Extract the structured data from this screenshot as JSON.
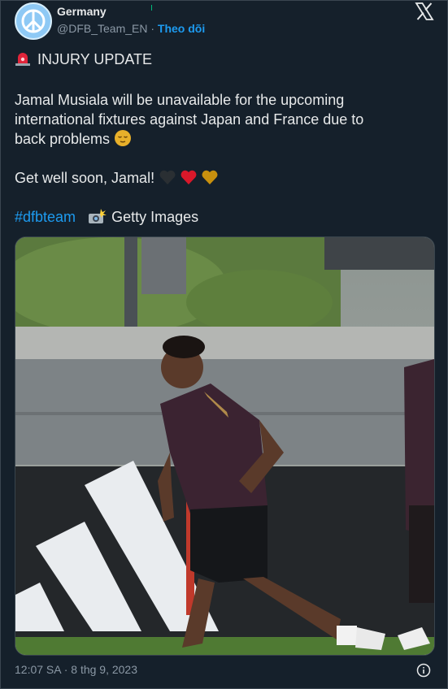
{
  "account": {
    "name": "Germany",
    "handle": "@DFB_Team_EN",
    "separator": " · ",
    "follow_label": "Theo dõi"
  },
  "post": {
    "heading": "INJURY UPDATE",
    "body_line1": "Jamal Musiala will be unavailable for the upcoming",
    "body_line2": "international fixtures against Japan and France due to",
    "body_line3": "back problems",
    "wish": "Get well soon, Jamal!",
    "hashtag": "#dfbteam",
    "credit": "Getty Images"
  },
  "media": {
    "description_icon": "photo",
    "logo_icon": "adidas-stripes-icon"
  },
  "meta": {
    "timestamp": "12:07 SA · 8 thg 9, 2023"
  },
  "icons": {
    "siren": "rotating-light-icon",
    "face": "relieved-face-icon",
    "hearts": [
      "black-heart-icon",
      "red-heart-icon",
      "gold-heart-icon"
    ],
    "camera": "camera-flash-icon",
    "x_logo": "x-logo-icon",
    "info": "info-icon"
  },
  "colors": {
    "background": "#15202b",
    "accent": "#1d9bf0",
    "muted": "#8b98a5",
    "red_heart": "#d9182a",
    "gold_heart": "#c8900e"
  }
}
